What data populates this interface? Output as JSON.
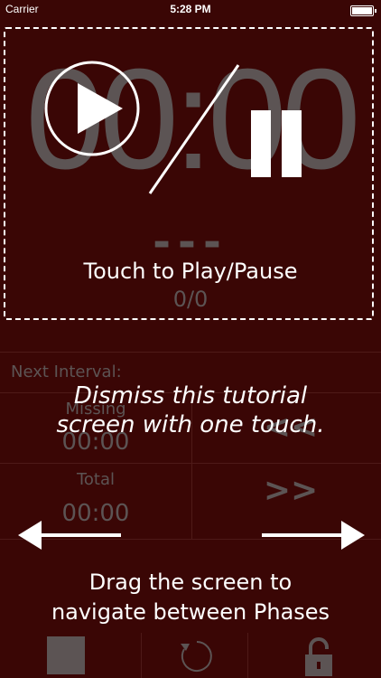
{
  "status_bar": {
    "carrier": "Carrier",
    "time": "5:28 PM"
  },
  "timer": {
    "display": "00:00",
    "phase": "---",
    "progress": "0/0"
  },
  "tutorial": {
    "play_pause": "Touch to Play/Pause",
    "dismiss_line1": "Dismiss this tutorial",
    "dismiss_line2": "screen with one touch.",
    "drag_line1": "Drag the screen to",
    "drag_line2": "navigate between Phases"
  },
  "interval": {
    "next_label": "Next Interval:",
    "missing_label": "Missing",
    "missing_value": "00:00",
    "total_label": "Total",
    "total_value": "00:00",
    "prev_nav": "<<",
    "next_nav": ">>"
  },
  "toolbar": {
    "stop_icon": "stop-icon",
    "reset_icon": "reset-icon",
    "lock_icon": "unlock-icon"
  },
  "colors": {
    "background": "#3a0605",
    "dim_text": "#5c5454",
    "tutorial_text": "#ffffff"
  }
}
